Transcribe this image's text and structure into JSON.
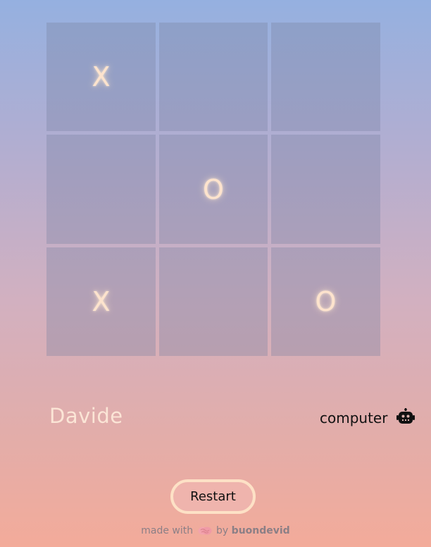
{
  "board": {
    "cells": [
      "X",
      "",
      "",
      "",
      "O",
      "",
      "X",
      "",
      "O"
    ]
  },
  "players": {
    "human": "Davide",
    "computer": "computer",
    "computer_icon": "robot-icon"
  },
  "restart_label": "Restart",
  "footer": {
    "made_with": "made with",
    "icon": "brain-icon",
    "by": "by",
    "author": "buondevid"
  },
  "colors": {
    "mark": "#fde3cd",
    "restart_border": "#fde1c6"
  }
}
